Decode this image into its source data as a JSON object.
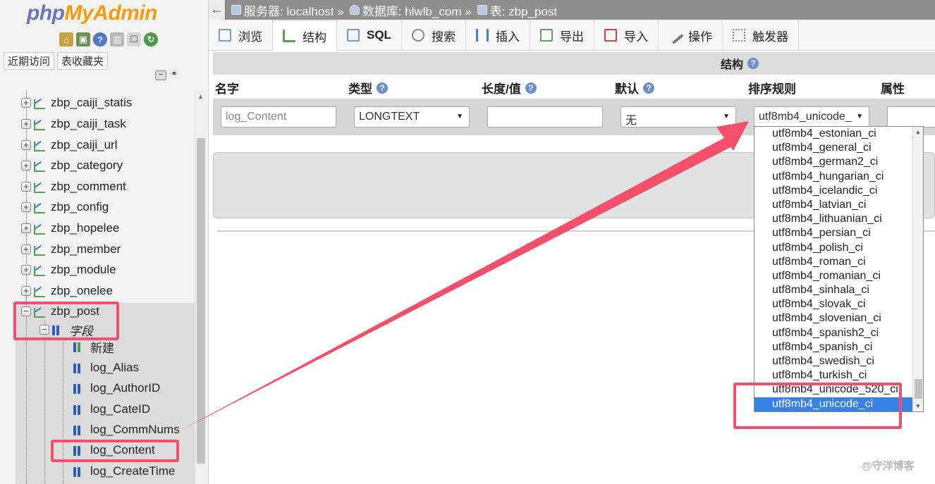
{
  "logo": {
    "php": "php",
    "my": "My",
    "admin": "Admin"
  },
  "nav_tabs": [
    "近期访问",
    "表收藏夹"
  ],
  "tree": {
    "tables": [
      "zbp_caiji_statis",
      "zbp_caiji_task",
      "zbp_caiji_url",
      "zbp_category",
      "zbp_comment",
      "zbp_config",
      "zbp_hopelee",
      "zbp_member",
      "zbp_module",
      "zbp_onelee",
      "zbp_post"
    ],
    "fields_node": "字段",
    "new_label": "新建",
    "columns": [
      "log_Alias",
      "log_AuthorID",
      "log_CateID",
      "log_CommNums",
      "log_Content",
      "log_CreateTime"
    ]
  },
  "breadcrumb": {
    "server": "服务器: localhost »",
    "database": "数据库: hlwlb_com »",
    "table": "表: zbp_post"
  },
  "menu": [
    "浏览",
    "结构",
    "SQL",
    "搜索",
    "插入",
    "导出",
    "导入",
    "操作",
    "触发器"
  ],
  "structure_title": "结构",
  "columns_header": {
    "name": "名字",
    "type": "类型",
    "length": "长度/值",
    "default": "默认",
    "collation": "排序规则",
    "attributes": "属性"
  },
  "row": {
    "name_value": "log_Content",
    "type_value": "LONGTEXT",
    "length_value": "",
    "default_value": "无",
    "collation_value": "utf8mb4_unicode_"
  },
  "collation_options": [
    "utf8mb4_estonian_ci",
    "utf8mb4_general_ci",
    "utf8mb4_german2_ci",
    "utf8mb4_hungarian_ci",
    "utf8mb4_icelandic_ci",
    "utf8mb4_latvian_ci",
    "utf8mb4_lithuanian_ci",
    "utf8mb4_persian_ci",
    "utf8mb4_polish_ci",
    "utf8mb4_roman_ci",
    "utf8mb4_romanian_ci",
    "utf8mb4_sinhala_ci",
    "utf8mb4_slovak_ci",
    "utf8mb4_slovenian_ci",
    "utf8mb4_spanish2_ci",
    "utf8mb4_spanish_ci",
    "utf8mb4_swedish_ci",
    "utf8mb4_turkish_ci",
    "utf8mb4_unicode_520_ci",
    "utf8mb4_unicode_ci"
  ],
  "selected_collation": "utf8mb4_unicode_ci",
  "watermark": "@守洋博客",
  "colors": {
    "annotation": "#f2506b",
    "selected": "#3a81e4",
    "topbar": "#8f8f8f"
  }
}
